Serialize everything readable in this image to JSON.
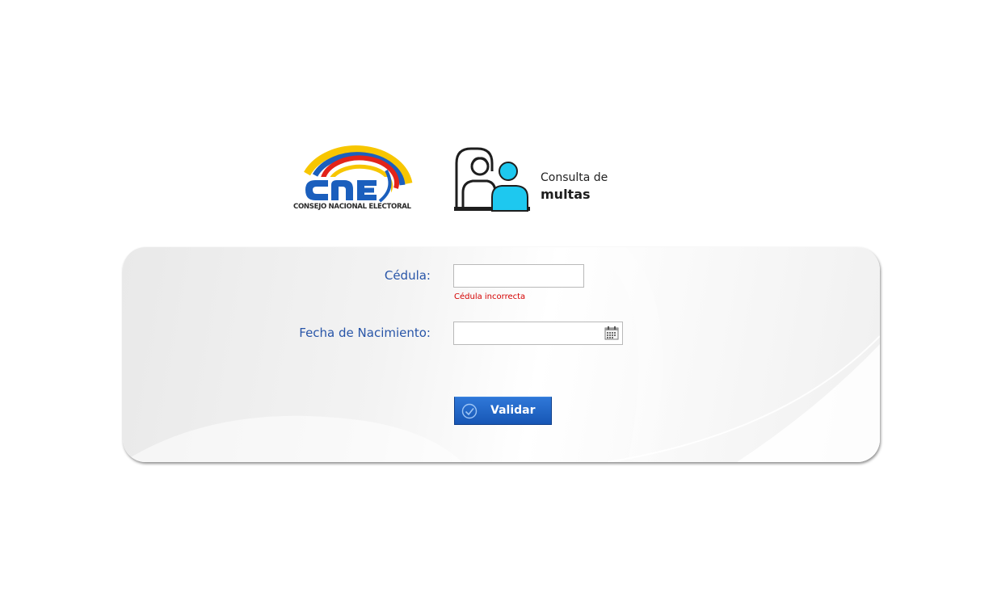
{
  "header": {
    "cne_logo_text": "CNE",
    "cne_tagline": "CONSEJO NACIONAL ELECTORAL",
    "multas_line1": "Consulta de",
    "multas_line2": "multas"
  },
  "form": {
    "cedula": {
      "label": "Cédula:",
      "value": "",
      "placeholder": "",
      "error": "Cédula incorrecta"
    },
    "fecha_nacimiento": {
      "label": "Fecha de Nacimiento:",
      "value": "",
      "placeholder": ""
    },
    "submit_label": "Validar"
  },
  "icons": {
    "cne_logo": "cne-arc-logo-icon",
    "multas_logo": "people-screen-icon",
    "calendar": "calendar-icon",
    "submit": "check-circle-icon"
  },
  "colors": {
    "label_blue": "#2855a8",
    "error_red": "#d40000",
    "button_blue": "#1f63c6",
    "cne_blue": "#1b5fbd",
    "arc_yellow": "#f7c600",
    "arc_blue": "#1b5fbd",
    "arc_red": "#e2231a",
    "person_cyan": "#1ec8ef"
  }
}
